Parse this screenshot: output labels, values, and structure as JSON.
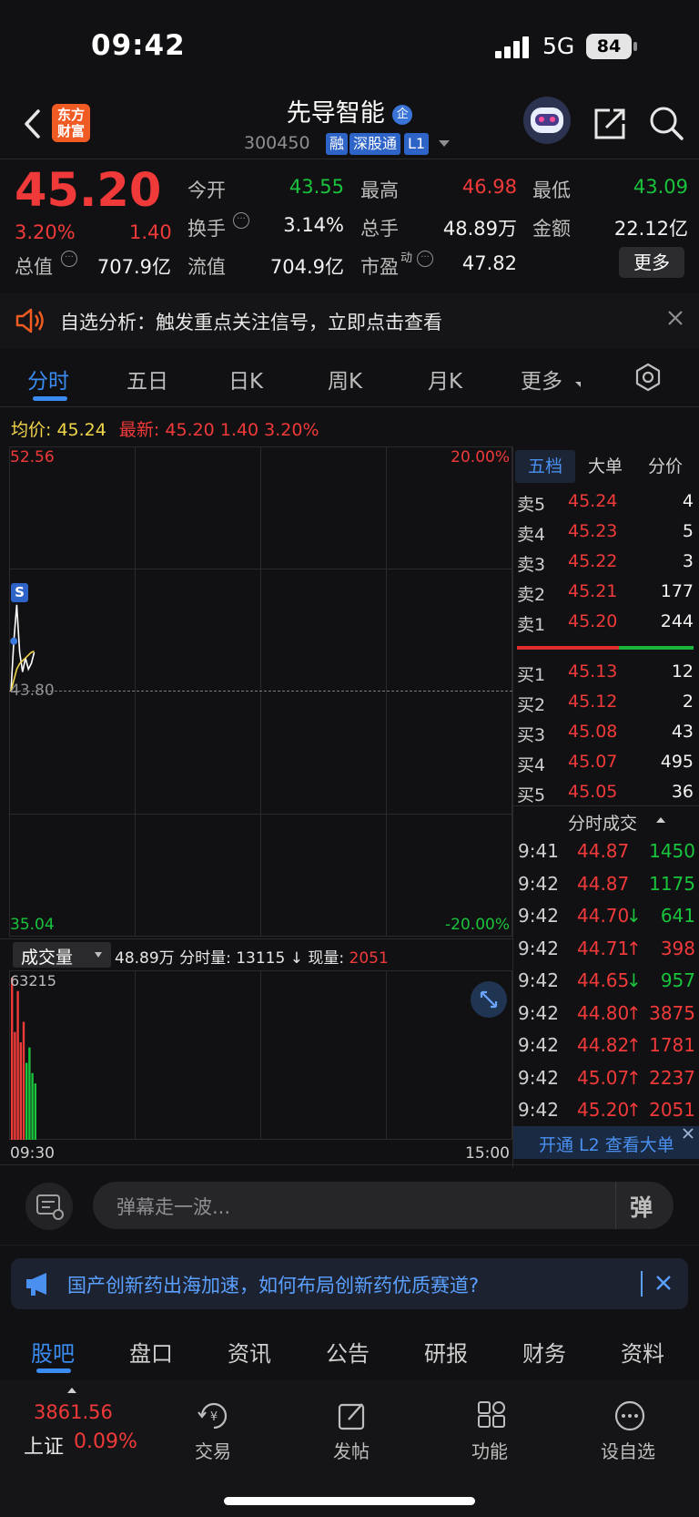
{
  "status_bar": {
    "time": "09:42",
    "network": "5G",
    "battery": "84"
  },
  "header": {
    "logo": "东方财富",
    "stock_name": "先导智能",
    "badge": "企",
    "stock_code": "300450",
    "tags": [
      "融",
      "深股通",
      "L1"
    ]
  },
  "quote": {
    "price": "45.20",
    "change_pct": "3.20%",
    "change": "1.40",
    "fields": [
      {
        "label": "今开",
        "value": "43.55"
      },
      {
        "label": "最高",
        "value": "46.98"
      },
      {
        "label": "最低",
        "value": "43.09"
      },
      {
        "label": "换手",
        "value": "3.14%"
      },
      {
        "label": "总手",
        "value": "48.89万"
      },
      {
        "label": "金额",
        "value": "22.12亿"
      },
      {
        "label": "总值",
        "value": "707.9亿"
      },
      {
        "label": "流值",
        "value": "704.9亿"
      },
      {
        "label": "市盈",
        "value": "47.82",
        "sup": "动"
      }
    ],
    "more_label": "更多"
  },
  "alert": {
    "text": "自选分析：触发重点关注信号，立即点击查看"
  },
  "chart_tabs": [
    "分时",
    "五日",
    "日K",
    "周K",
    "月K",
    "更多"
  ],
  "price_info": {
    "avg_label": "均价:",
    "avg": "45.24",
    "latest_label": "最新:",
    "latest": "45.20",
    "change": "1.40",
    "pct": "3.20%"
  },
  "chart_data": {
    "type": "line",
    "y_max": "52.56",
    "y_min": "35.04",
    "y_ref": "43.80",
    "pct_max": "20.00%",
    "pct_min": "-20.00%",
    "ylim": [
      35.04,
      52.56
    ],
    "marker_label": "S",
    "x_start": "09:30",
    "x_end": "15:00",
    "series": [
      {
        "values": [
          43.8,
          45.6,
          46.9,
          45.2,
          44.5,
          45.0,
          44.6,
          44.8,
          45.2
        ]
      },
      {
        "values": [
          43.8,
          44.2,
          44.6,
          44.8,
          44.9,
          45.0,
          45.1,
          45.2,
          45.24
        ]
      }
    ]
  },
  "volume": {
    "label": "成交量",
    "total": "48.89万",
    "minute_label": "分时量:",
    "minute_value": "13115",
    "current_label": "现量:",
    "current_value": "2051",
    "max_label": "63215",
    "bars": [
      {
        "v": 63215,
        "c": "red"
      },
      {
        "v": 42000,
        "c": "red"
      },
      {
        "v": 58000,
        "c": "red"
      },
      {
        "v": 38000,
        "c": "red"
      },
      {
        "v": 46000,
        "c": "red"
      },
      {
        "v": 30000,
        "c": "green"
      },
      {
        "v": 36000,
        "c": "green"
      },
      {
        "v": 26000,
        "c": "green"
      },
      {
        "v": 22000,
        "c": "green"
      }
    ]
  },
  "orderbook": {
    "tabs": [
      "五档",
      "大单",
      "分价"
    ],
    "sell": [
      {
        "label": "卖5",
        "price": "45.24",
        "vol": "4"
      },
      {
        "label": "卖4",
        "price": "45.23",
        "vol": "5"
      },
      {
        "label": "卖3",
        "price": "45.22",
        "vol": "3"
      },
      {
        "label": "卖2",
        "price": "45.21",
        "vol": "177"
      },
      {
        "label": "卖1",
        "price": "45.20",
        "vol": "244"
      }
    ],
    "buy": [
      {
        "label": "买1",
        "price": "45.13",
        "vol": "12"
      },
      {
        "label": "买2",
        "price": "45.12",
        "vol": "2"
      },
      {
        "label": "买3",
        "price": "45.08",
        "vol": "43"
      },
      {
        "label": "买4",
        "price": "45.07",
        "vol": "495"
      },
      {
        "label": "买5",
        "price": "45.05",
        "vol": "36"
      }
    ]
  },
  "trades": {
    "title": "分时成交",
    "rows": [
      {
        "time": "9:41",
        "price": "44.87",
        "dir": "",
        "vol": "1450",
        "vc": "green"
      },
      {
        "time": "9:42",
        "price": "44.87",
        "dir": "",
        "vol": "1175",
        "vc": "green"
      },
      {
        "time": "9:42",
        "price": "44.70",
        "dir": "↓",
        "vol": "641",
        "vc": "green"
      },
      {
        "time": "9:42",
        "price": "44.71",
        "dir": "↑",
        "vol": "398",
        "vc": "red"
      },
      {
        "time": "9:42",
        "price": "44.65",
        "dir": "↓",
        "vol": "957",
        "vc": "green"
      },
      {
        "time": "9:42",
        "price": "44.80",
        "dir": "↑",
        "vol": "3875",
        "vc": "red"
      },
      {
        "time": "9:42",
        "price": "44.82",
        "dir": "↑",
        "vol": "1781",
        "vc": "red"
      },
      {
        "time": "9:42",
        "price": "45.07",
        "dir": "↑",
        "vol": "2237",
        "vc": "red"
      },
      {
        "time": "9:42",
        "price": "45.20",
        "dir": "↑",
        "vol": "2051",
        "vc": "red"
      }
    ],
    "l2_banner": "开通 L2 查看大单"
  },
  "comment": {
    "placeholder": "弹幕走一波...",
    "send_icon": "弹"
  },
  "news": {
    "text": "国产创新药出海加速，如何布局创新药优质赛道?"
  },
  "section_tabs": [
    "股吧",
    "盘口",
    "资讯",
    "公告",
    "研报",
    "财务",
    "资料"
  ],
  "bottom_nav": {
    "index_value": "3861.56",
    "index_name": "上证",
    "index_pct": "0.09%",
    "items": [
      "交易",
      "发帖",
      "功能",
      "设自选"
    ]
  },
  "colors": {
    "up": "#f03a3a",
    "down": "#19c33c",
    "accent": "#2e7ad8",
    "avg_line": "#f2d64a",
    "price_line": "#ffffff"
  }
}
